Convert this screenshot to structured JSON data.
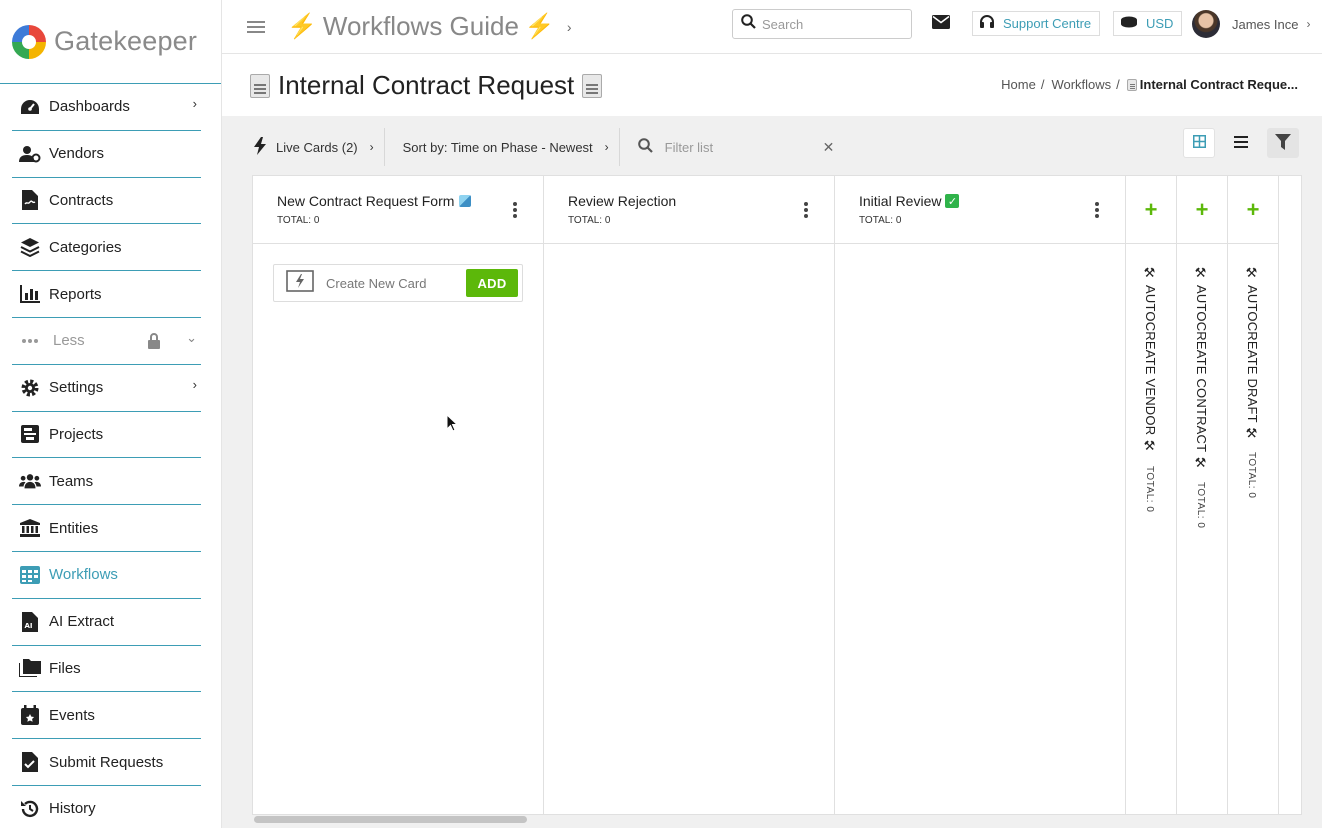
{
  "app": {
    "logo_text": "Gatekeeper",
    "accent": "#3d9db5",
    "green": "#5cb80a"
  },
  "sidebar": {
    "items": [
      {
        "label": "Dashboards",
        "icon": "dashboard-icon",
        "chevron": true
      },
      {
        "label": "Vendors",
        "icon": "vendors-icon"
      },
      {
        "label": "Contracts",
        "icon": "contracts-icon"
      },
      {
        "label": "Categories",
        "icon": "categories-icon"
      },
      {
        "label": "Reports",
        "icon": "reports-icon"
      },
      {
        "label": "Less",
        "icon": "more-icon",
        "locked": true
      },
      {
        "label": "Settings",
        "icon": "settings-icon",
        "chevron": true
      },
      {
        "label": "Projects",
        "icon": "projects-icon"
      },
      {
        "label": "Teams",
        "icon": "teams-icon"
      },
      {
        "label": "Entities",
        "icon": "entities-icon"
      },
      {
        "label": "Workflows",
        "icon": "workflows-icon",
        "active": true
      },
      {
        "label": "AI Extract",
        "icon": "ai-extract-icon"
      },
      {
        "label": "Files",
        "icon": "files-icon"
      },
      {
        "label": "Events",
        "icon": "events-icon"
      },
      {
        "label": "Submit Requests",
        "icon": "submit-requests-icon"
      },
      {
        "label": "History",
        "icon": "history-icon"
      }
    ]
  },
  "topbar": {
    "title": "Workflows Guide",
    "search_placeholder": "Search",
    "support_label": "Support Centre",
    "currency_label": "USD",
    "user_name": "James Ince"
  },
  "page": {
    "title": "Internal Contract Request",
    "breadcrumb": {
      "home": "Home",
      "workflows": "Workflows",
      "current": "Internal Contract Reque..."
    }
  },
  "toolbar": {
    "live_cards": "Live Cards (2)",
    "sort_label": "Sort by: Time on Phase - Newest",
    "filter_placeholder": "Filter list"
  },
  "board": {
    "columns": [
      {
        "name": "New Contract Request Form",
        "total": "TOTAL: 0"
      },
      {
        "name": "Review Rejection",
        "total": "TOTAL: 0"
      },
      {
        "name": "Initial Review",
        "total": "TOTAL: 0"
      }
    ],
    "create_card": {
      "label": "Create New Card",
      "button": "ADD"
    },
    "collapsed": [
      {
        "name": "AUTOCREATE VENDOR",
        "total": "TOTAL: 0"
      },
      {
        "name": "AUTOCREATE CONTRACT",
        "total": "TOTAL: 0"
      },
      {
        "name": "AUTOCREATE DRAFT",
        "total": "TOTAL: 0"
      }
    ]
  }
}
